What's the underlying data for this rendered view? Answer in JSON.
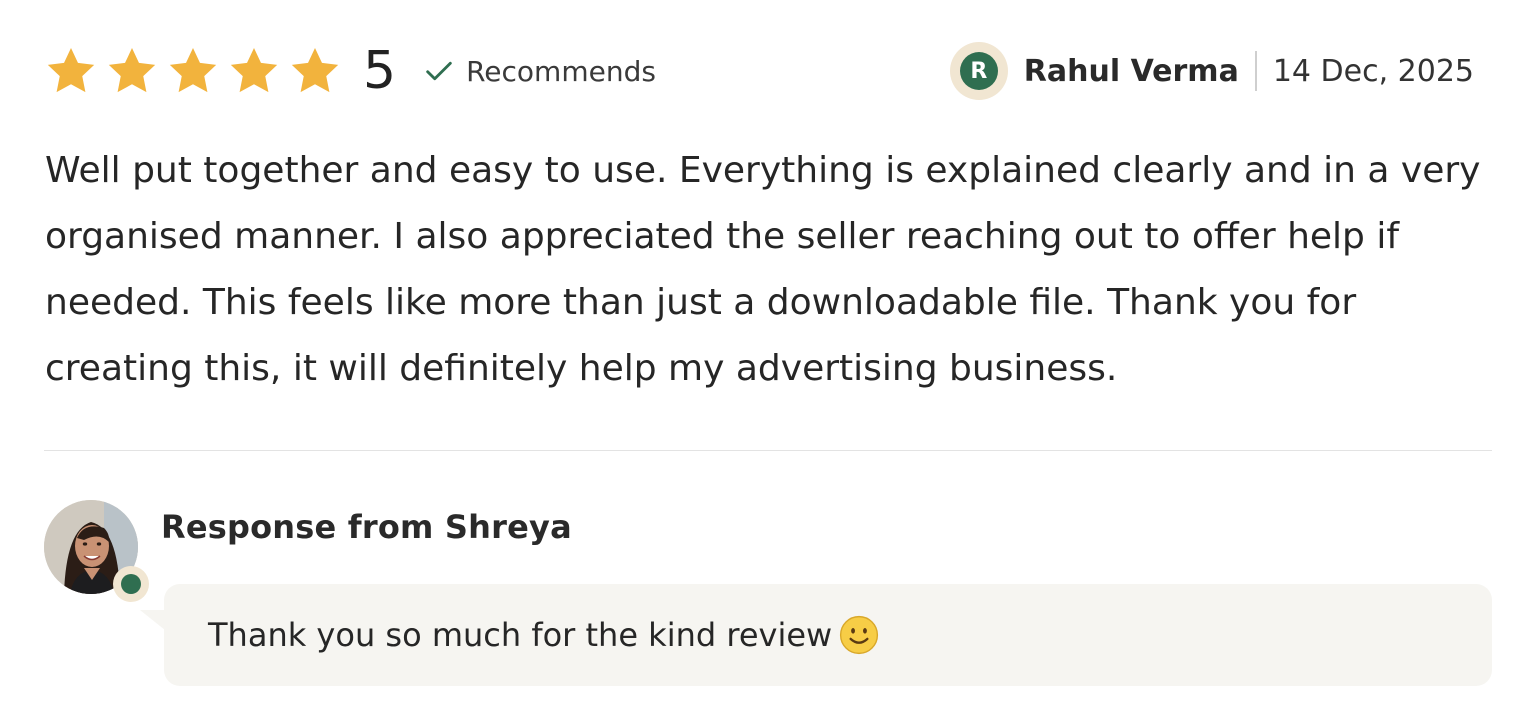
{
  "review": {
    "rating": 5,
    "rating_max": 5,
    "rating_text": "5",
    "recommends_label": "Recommends",
    "author": {
      "initial": "R",
      "name": "Rahul Verma"
    },
    "date": "14 Dec, 2025",
    "body": "Well put together and easy to use. Everything is explained clearly and in a very organised manner. I also appreciated the seller reaching out to offer help if needed. This feels like more than just a downloadable file. Thank you for creating this, it will definitely help my advertising business."
  },
  "response": {
    "title": "Response from Shreya",
    "text": "Thank you so much for the kind review"
  },
  "icons": {
    "star": "star-icon",
    "check": "check-icon",
    "smiley": "smiley-icon"
  },
  "colors": {
    "star": "#F2B33D",
    "accent_green": "#2F6E50",
    "avatar_ring": "#F1E6D2",
    "bubble_bg": "#F6F5F1"
  }
}
